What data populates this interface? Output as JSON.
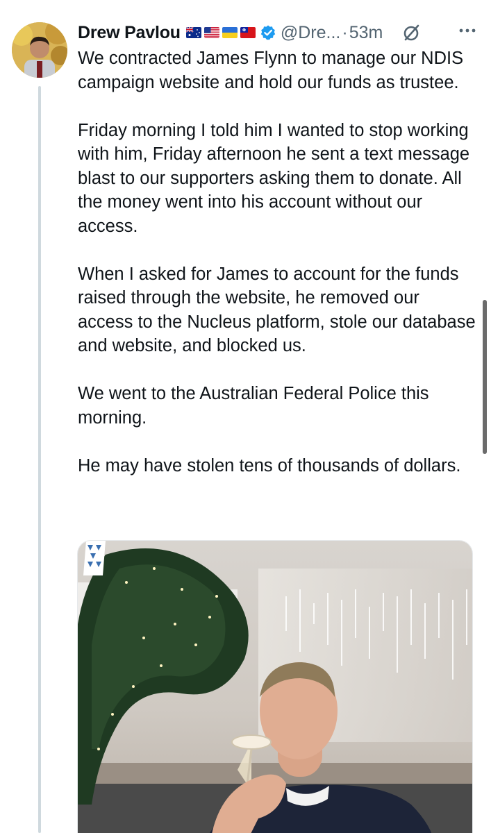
{
  "tweet": {
    "author": {
      "display_name": "Drew Pavlou",
      "flags": [
        "australia-flag",
        "usa-flag",
        "ukraine-flag",
        "taiwan-flag"
      ],
      "verified": true,
      "handle": "@Dre...",
      "separator": "·",
      "time": "53m"
    },
    "paragraphs": [
      "We contracted James Flynn to manage our NDIS campaign website and hold our funds as trustee.",
      "Friday morning I told him I wanted to stop working with him, Friday afternoon he sent a text message blast to our supporters asking them to donate. All the money went into his account without our access.",
      "When I asked for James to account for the funds raised through the website, he removed our access to the Nucleus platform, stole our database and website, and blocked us.",
      "We went to the Australian Federal Police this morning.",
      "He may have stolen tens of thousands of dollars."
    ],
    "icons": {
      "grok": "grok-icon",
      "more": "more-options-icon",
      "verified": "verified-badge-icon"
    },
    "colors": {
      "text": "#0f1419",
      "secondary": "#536471",
      "verified": "#1d9bf0",
      "thread_line": "#cfd9de"
    }
  }
}
